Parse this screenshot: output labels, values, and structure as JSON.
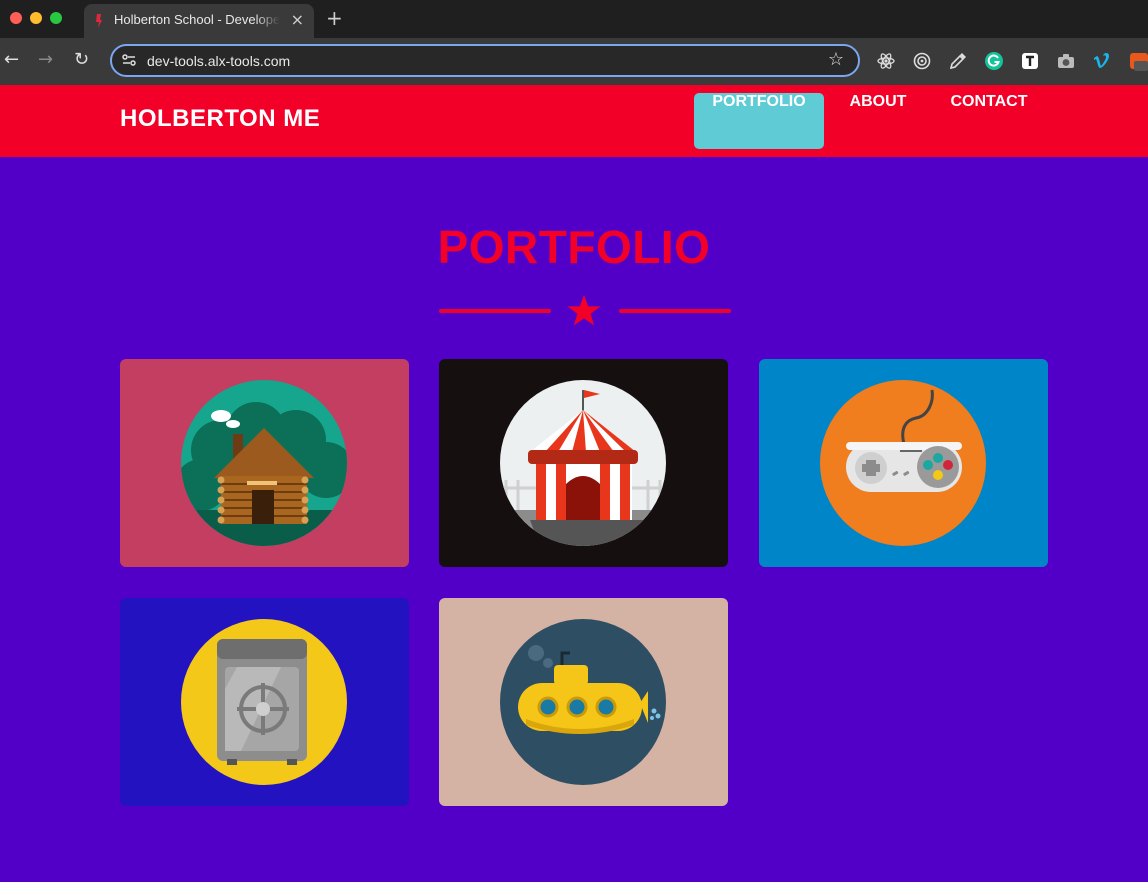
{
  "browser": {
    "tab_title": "Holberton School - Developer Tools",
    "tab_close": "×",
    "new_tab": "+",
    "url": "dev-tools.alx-tools.com",
    "back": "←",
    "forward": "→",
    "reload": "↻",
    "bookmark": "☆"
  },
  "site": {
    "brand": "HOLBERTON ME",
    "nav": [
      {
        "label": "PORTFOLIO",
        "active": true
      },
      {
        "label": "ABOUT",
        "active": false
      },
      {
        "label": "CONTACT",
        "active": false
      }
    ]
  },
  "portfolio": {
    "title": "PORTFOLIO",
    "items": [
      {
        "name": "cabin",
        "background": "#c43e62",
        "circle": "#16a58d"
      },
      {
        "name": "circus",
        "background": "#160f10",
        "circle": "#ecf0f1"
      },
      {
        "name": "game",
        "background": "#0086c8",
        "circle": "#f07d1e"
      },
      {
        "name": "safe",
        "background": "#2312c0",
        "circle": "#f3c818"
      },
      {
        "name": "submarine",
        "background": "#d4b3a4",
        "circle": "#2e4e63"
      }
    ]
  },
  "colors": {
    "accent": "#f20028",
    "page_background": "#5200c8",
    "active_nav": "#5ecbd5"
  }
}
